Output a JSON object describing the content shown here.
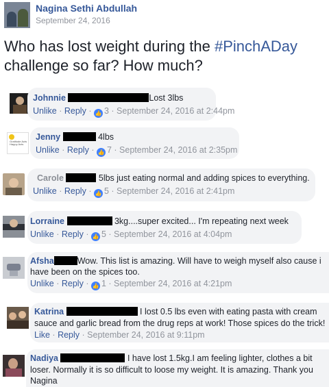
{
  "post": {
    "author": "Nagina Sethi Abdullah",
    "date": "September 24, 2016",
    "text_before": "Who has lost weight during the ",
    "hashtag": "#PinchADay",
    "text_after": " challenge so far? How much?"
  },
  "avatar_colors": {
    "blue": "#365899",
    "grey": "#90949c",
    "bubble": "#f2f3f5",
    "like": "#4080ff"
  },
  "comments": [
    {
      "name": "Johnnie",
      "text": "Lost 3lbs",
      "unlike": "Unlike",
      "reply": "Reply",
      "likes": "3",
      "time": "September 24, 2016 at 2:44pm"
    },
    {
      "name": "Jenny",
      "text": "4lbs",
      "unlike": "Unlike",
      "reply": "Reply",
      "likes": "7",
      "time": "September 24, 2016 at 2:35pm",
      "avatar_text": "Gratitude Acts Happy Acts"
    },
    {
      "name": "Carole",
      "text": "5lbs just eating normal and adding spices to everything.",
      "unlike": "Unlike",
      "reply": "Reply",
      "likes": "5",
      "time": "September 24, 2016 at 2:41pm"
    },
    {
      "name": "Lorraine",
      "text": "3kg....super excited... I'm repeating next week",
      "unlike": "Unlike",
      "reply": "Reply",
      "likes": "5",
      "time": "September 24, 2016 at 4:04pm"
    },
    {
      "name": "Afsha",
      "text_line1": "Wow. This list is amazing. Will have to weigh myself also cause i",
      "text_line2": "have been on the spices too.",
      "unlike": "Unlike",
      "reply": "Reply",
      "likes": "1",
      "time": "September 24, 2016 at 4:21pm"
    },
    {
      "name": "Katrina",
      "text_line1": "I lost 0.5 lbs even with eating pasta with cream",
      "text_line2": "sauce and garlic bread from the drug reps at work! Those spices do the trick!",
      "like": "Like",
      "reply": "Reply",
      "time": "September 24, 2016 at 9:11pm"
    },
    {
      "name": "Nadiya",
      "text_line1": "I have lost 1.5kg.I am feeling lighter, clothes a bit",
      "text_line2": "loser. Normally it is so difficult to loose my weight. It is amazing. Thank you",
      "text_line3": "Nagina"
    }
  ]
}
